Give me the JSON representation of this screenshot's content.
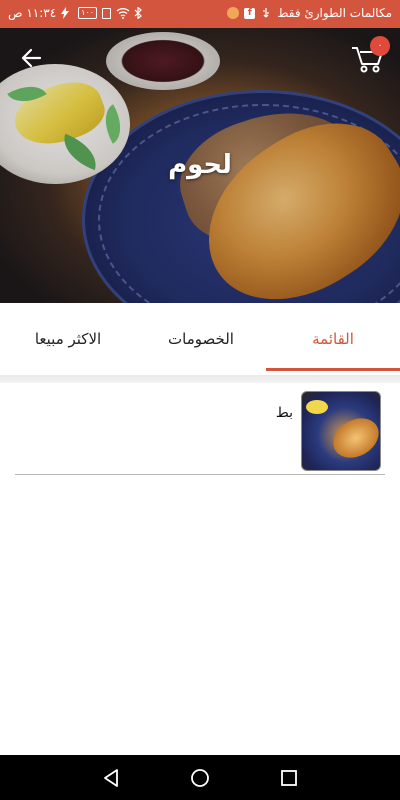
{
  "status_bar": {
    "carrier_text": "مكالمات الطوارئ فقط",
    "time": "١١:٣٤ ص",
    "battery": "١٠٠",
    "icons": [
      "notification-dot-icon",
      "facebook-icon",
      "usb-icon",
      "bluetooth-icon",
      "vibrate-icon",
      "wifi-icon",
      "battery-icon",
      "charging-icon"
    ]
  },
  "hero": {
    "title": "لحوم",
    "cart_count": "٠"
  },
  "tabs": {
    "items": [
      {
        "label": "القائمة",
        "active": true
      },
      {
        "label": "الخصومات",
        "active": false
      },
      {
        "label": "الاكثر مبيعا",
        "active": false
      }
    ]
  },
  "menu": {
    "items": [
      {
        "name": "بط"
      }
    ]
  },
  "colors": {
    "accent": "#d4553e",
    "badge": "#e04a3c"
  }
}
